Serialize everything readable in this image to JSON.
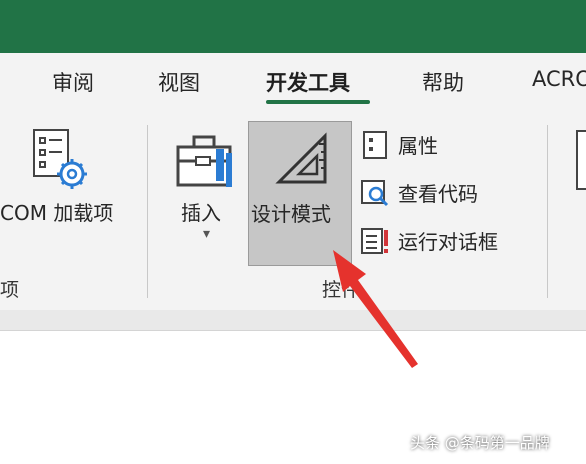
{
  "tabs": [
    {
      "label": "审阅"
    },
    {
      "label": "视图"
    },
    {
      "label": "开发工具"
    },
    {
      "label": "帮助"
    },
    {
      "label": "ACRO"
    }
  ],
  "addins": {
    "label": "COM 加载项",
    "group_label": "项"
  },
  "insert": {
    "label": "插入",
    "dropdown": "▾"
  },
  "design_mode": {
    "label": "设计模式"
  },
  "controls_small": [
    {
      "label": "属性"
    },
    {
      "label": "查看代码"
    },
    {
      "label": "运行对话框"
    }
  ],
  "controls_group_label": "控件",
  "watermark": "头条 @条码第一品牌",
  "colors": {
    "accent": "#217346",
    "annotation_arrow": "#e5322d"
  }
}
